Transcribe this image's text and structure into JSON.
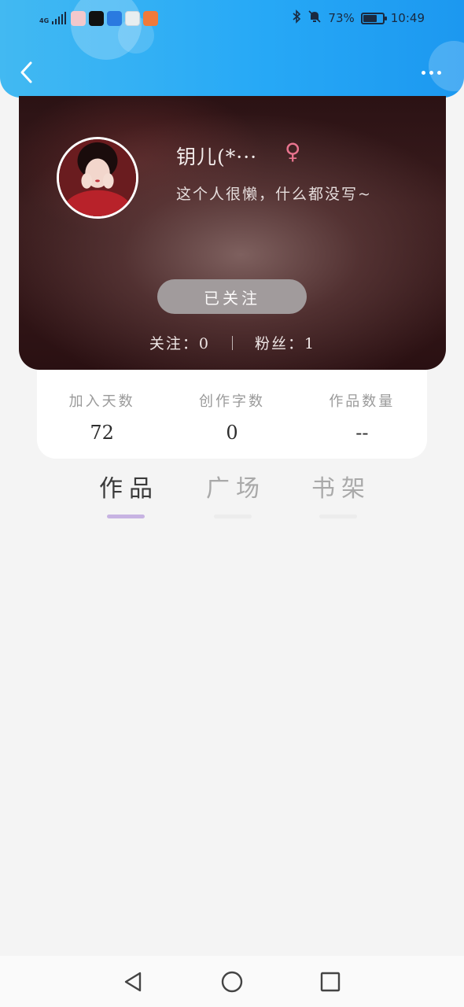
{
  "status_bar": {
    "network": "4G",
    "battery": "73%",
    "battery_level": 0.73,
    "time": "10:49",
    "icons": [
      "signal-icon",
      "app-icon",
      "tiktok-icon",
      "app-icon",
      "app-icon",
      "app-icon",
      "bluetooth-icon",
      "bell-muted-icon",
      "battery-icon"
    ]
  },
  "header": {
    "back_icon": "chevron-left-icon",
    "more_icon": "more-dots-icon",
    "colors": {
      "header": "#27a9f6"
    }
  },
  "profile": {
    "nickname": "钥儿(*···",
    "gender_symbol": "♀",
    "signature": "这个人很懒，什么都没写~",
    "follow_button": "已关注",
    "following_label": "关注：",
    "following_count": "0",
    "fans_label": "粉丝：",
    "fans_count": "1",
    "colors": {
      "gender": "#e9748f",
      "follow_button": "#a19b9c"
    }
  },
  "stats": [
    {
      "label": "加入天数",
      "value": "72"
    },
    {
      "label": "创作字数",
      "value": "0"
    },
    {
      "label": "作品数量",
      "value": "--"
    }
  ],
  "tabs": [
    {
      "label": "作品",
      "active": true
    },
    {
      "label": "广场",
      "active": false
    },
    {
      "label": "书架",
      "active": false
    }
  ],
  "nav_bar": {
    "icons": [
      "back-triangle-icon",
      "home-circle-icon",
      "recents-square-icon"
    ]
  }
}
